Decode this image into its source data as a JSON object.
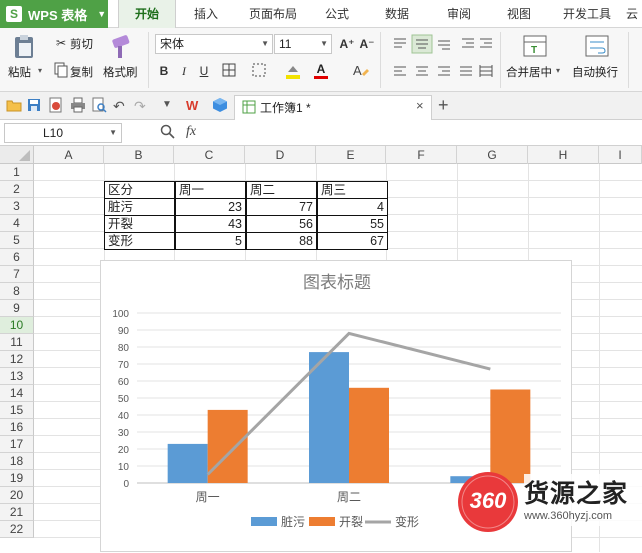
{
  "app": {
    "name": "WPS 表格",
    "logo": "S"
  },
  "menu_tabs": [
    "开始",
    "插入",
    "页面布局",
    "公式",
    "数据",
    "审阅",
    "视图",
    "开发工具",
    "云"
  ],
  "ribbon": {
    "paste": "粘贴",
    "cut": "剪切",
    "copy": "复制",
    "format_painter": "格式刷",
    "font_name": "宋体",
    "font_size": "11",
    "bold": "B",
    "italic": "I",
    "underline": "U",
    "font_grow": "A⁺",
    "font_shrink": "A⁻",
    "font_color_letter": "A",
    "merge_center": "合并居中",
    "wrap_text": "自动换行"
  },
  "document_tab": {
    "title": "工作簿1 *"
  },
  "formula_bar": {
    "cell_ref": "L10",
    "fx": "fx",
    "value": ""
  },
  "columns": [
    "A",
    "B",
    "C",
    "D",
    "E",
    "F",
    "G",
    "H",
    "I"
  ],
  "rows": [
    "1",
    "2",
    "3",
    "4",
    "5",
    "6",
    "7",
    "8",
    "9",
    "10",
    "11",
    "12",
    "13",
    "14",
    "15",
    "16",
    "17",
    "18",
    "19",
    "20",
    "21",
    "22"
  ],
  "selected_row": "10",
  "table": {
    "header": [
      "区分",
      "周一",
      "周二",
      "周三"
    ],
    "rows": [
      [
        "脏污",
        "23",
        "77",
        "4"
      ],
      [
        "开裂",
        "43",
        "56",
        "55"
      ],
      [
        "变形",
        "5",
        "88",
        "67"
      ]
    ]
  },
  "chart_data": {
    "type": "bar",
    "title": "图表标题",
    "categories": [
      "周一",
      "周二",
      "周三"
    ],
    "series": [
      {
        "name": "脏污",
        "type": "bar",
        "color": "#5b9bd5",
        "values": [
          23,
          77,
          4
        ]
      },
      {
        "name": "开裂",
        "type": "bar",
        "color": "#ed7d31",
        "values": [
          43,
          56,
          55
        ]
      },
      {
        "name": "变形",
        "type": "line",
        "color": "#a5a5a5",
        "values": [
          5,
          88,
          67
        ]
      }
    ],
    "ylim": [
      0,
      100
    ],
    "yticks": [
      "0",
      "10",
      "20",
      "30",
      "40",
      "50",
      "60",
      "70",
      "80",
      "90",
      "100"
    ],
    "grid": true,
    "legend": "bottom"
  },
  "watermark": {
    "logo_number": "360",
    "brand": "货源之家",
    "url": "www.360hyzj.com"
  },
  "colors": {
    "accent": "#4fa146",
    "selection": "#2a7a24"
  }
}
